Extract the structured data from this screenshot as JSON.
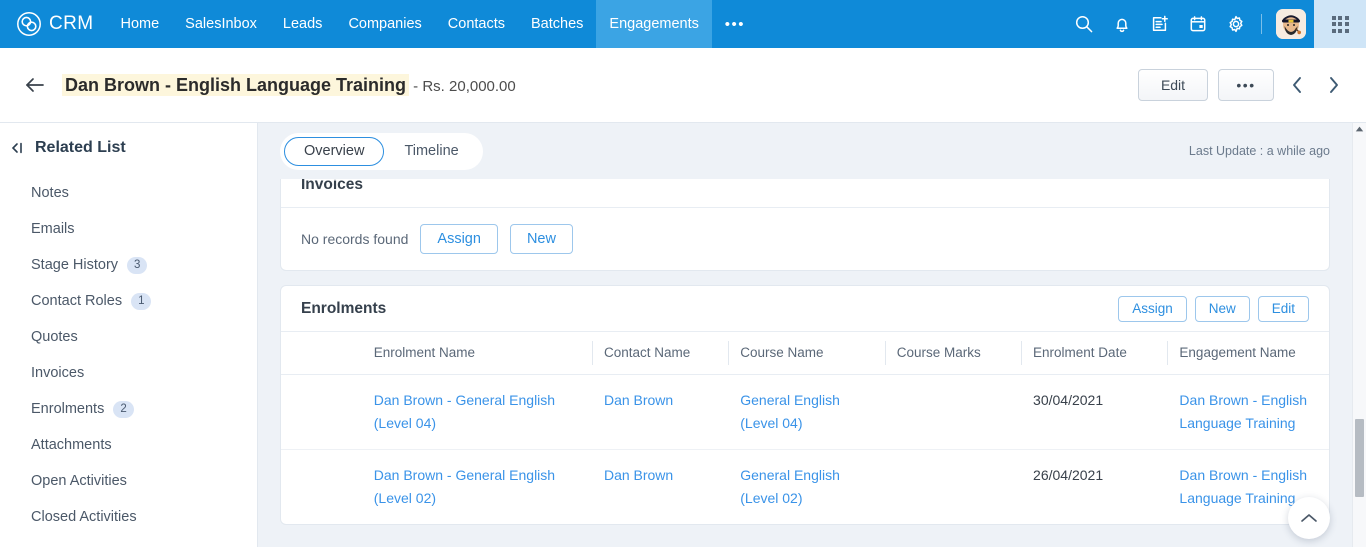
{
  "topnav": {
    "brand": "CRM",
    "items": [
      {
        "label": "Home",
        "active": false
      },
      {
        "label": "SalesInbox",
        "active": false
      },
      {
        "label": "Leads",
        "active": false
      },
      {
        "label": "Companies",
        "active": false
      },
      {
        "label": "Contacts",
        "active": false
      },
      {
        "label": "Batches",
        "active": false
      },
      {
        "label": "Engagements",
        "active": true
      }
    ],
    "more_label": "•••",
    "icons": [
      "search-icon",
      "bell-icon",
      "add-note-icon",
      "calendar-icon",
      "settings-icon"
    ],
    "accent_color": "#0f8ad8",
    "active_tab_color": "#3ba4e4"
  },
  "record_header": {
    "back_label": "←",
    "title": "Dan Brown - English Language Training",
    "subtitle": " - Rs. 20,000.00",
    "highlight_color": "#fdf6dc",
    "edit_label": "Edit",
    "more_label": "•••",
    "prev_label": "‹",
    "next_label": "›"
  },
  "sidebar": {
    "title": "Related List",
    "items": [
      {
        "label": "Notes",
        "badge": ""
      },
      {
        "label": "Emails",
        "badge": ""
      },
      {
        "label": "Stage History",
        "badge": "3"
      },
      {
        "label": "Contact Roles",
        "badge": "1"
      },
      {
        "label": "Quotes",
        "badge": ""
      },
      {
        "label": "Invoices",
        "badge": ""
      },
      {
        "label": "Enrolments",
        "badge": "2"
      },
      {
        "label": "Attachments",
        "badge": ""
      },
      {
        "label": "Open Activities",
        "badge": ""
      },
      {
        "label": "Closed Activities",
        "badge": ""
      }
    ]
  },
  "content": {
    "tabs": [
      {
        "label": "Overview",
        "active": true
      },
      {
        "label": "Timeline",
        "active": false
      }
    ],
    "last_update": "Last Update : a while ago",
    "invoices_card": {
      "title": "Invoices",
      "empty_text": "No records found",
      "assign_label": "Assign",
      "new_label": "New"
    },
    "enrolments_card": {
      "title": "Enrolments",
      "assign_label": "Assign",
      "new_label": "New",
      "edit_label": "Edit",
      "columns": [
        "Enrolment Name",
        "Contact Name",
        "Course Name",
        "Course Marks",
        "Enrolment Date",
        "Engagement Name"
      ],
      "rows": [
        {
          "enrolment_name": "Dan Brown - General English (Level 04)",
          "contact_name": "Dan Brown",
          "course_name": "General English (Level 04)",
          "course_marks": "",
          "enrolment_date": "30/04/2021",
          "engagement_name": "Dan Brown - English Language Training"
        },
        {
          "enrolment_name": "Dan Brown - General English (Level 02)",
          "contact_name": "Dan Brown",
          "course_name": "General English (Level 02)",
          "course_marks": "",
          "enrolment_date": "26/04/2021",
          "engagement_name": "Dan Brown - English Language Training"
        }
      ]
    },
    "scroll_top_icon": "chevron-up-icon",
    "link_color": "#3a93e8"
  }
}
